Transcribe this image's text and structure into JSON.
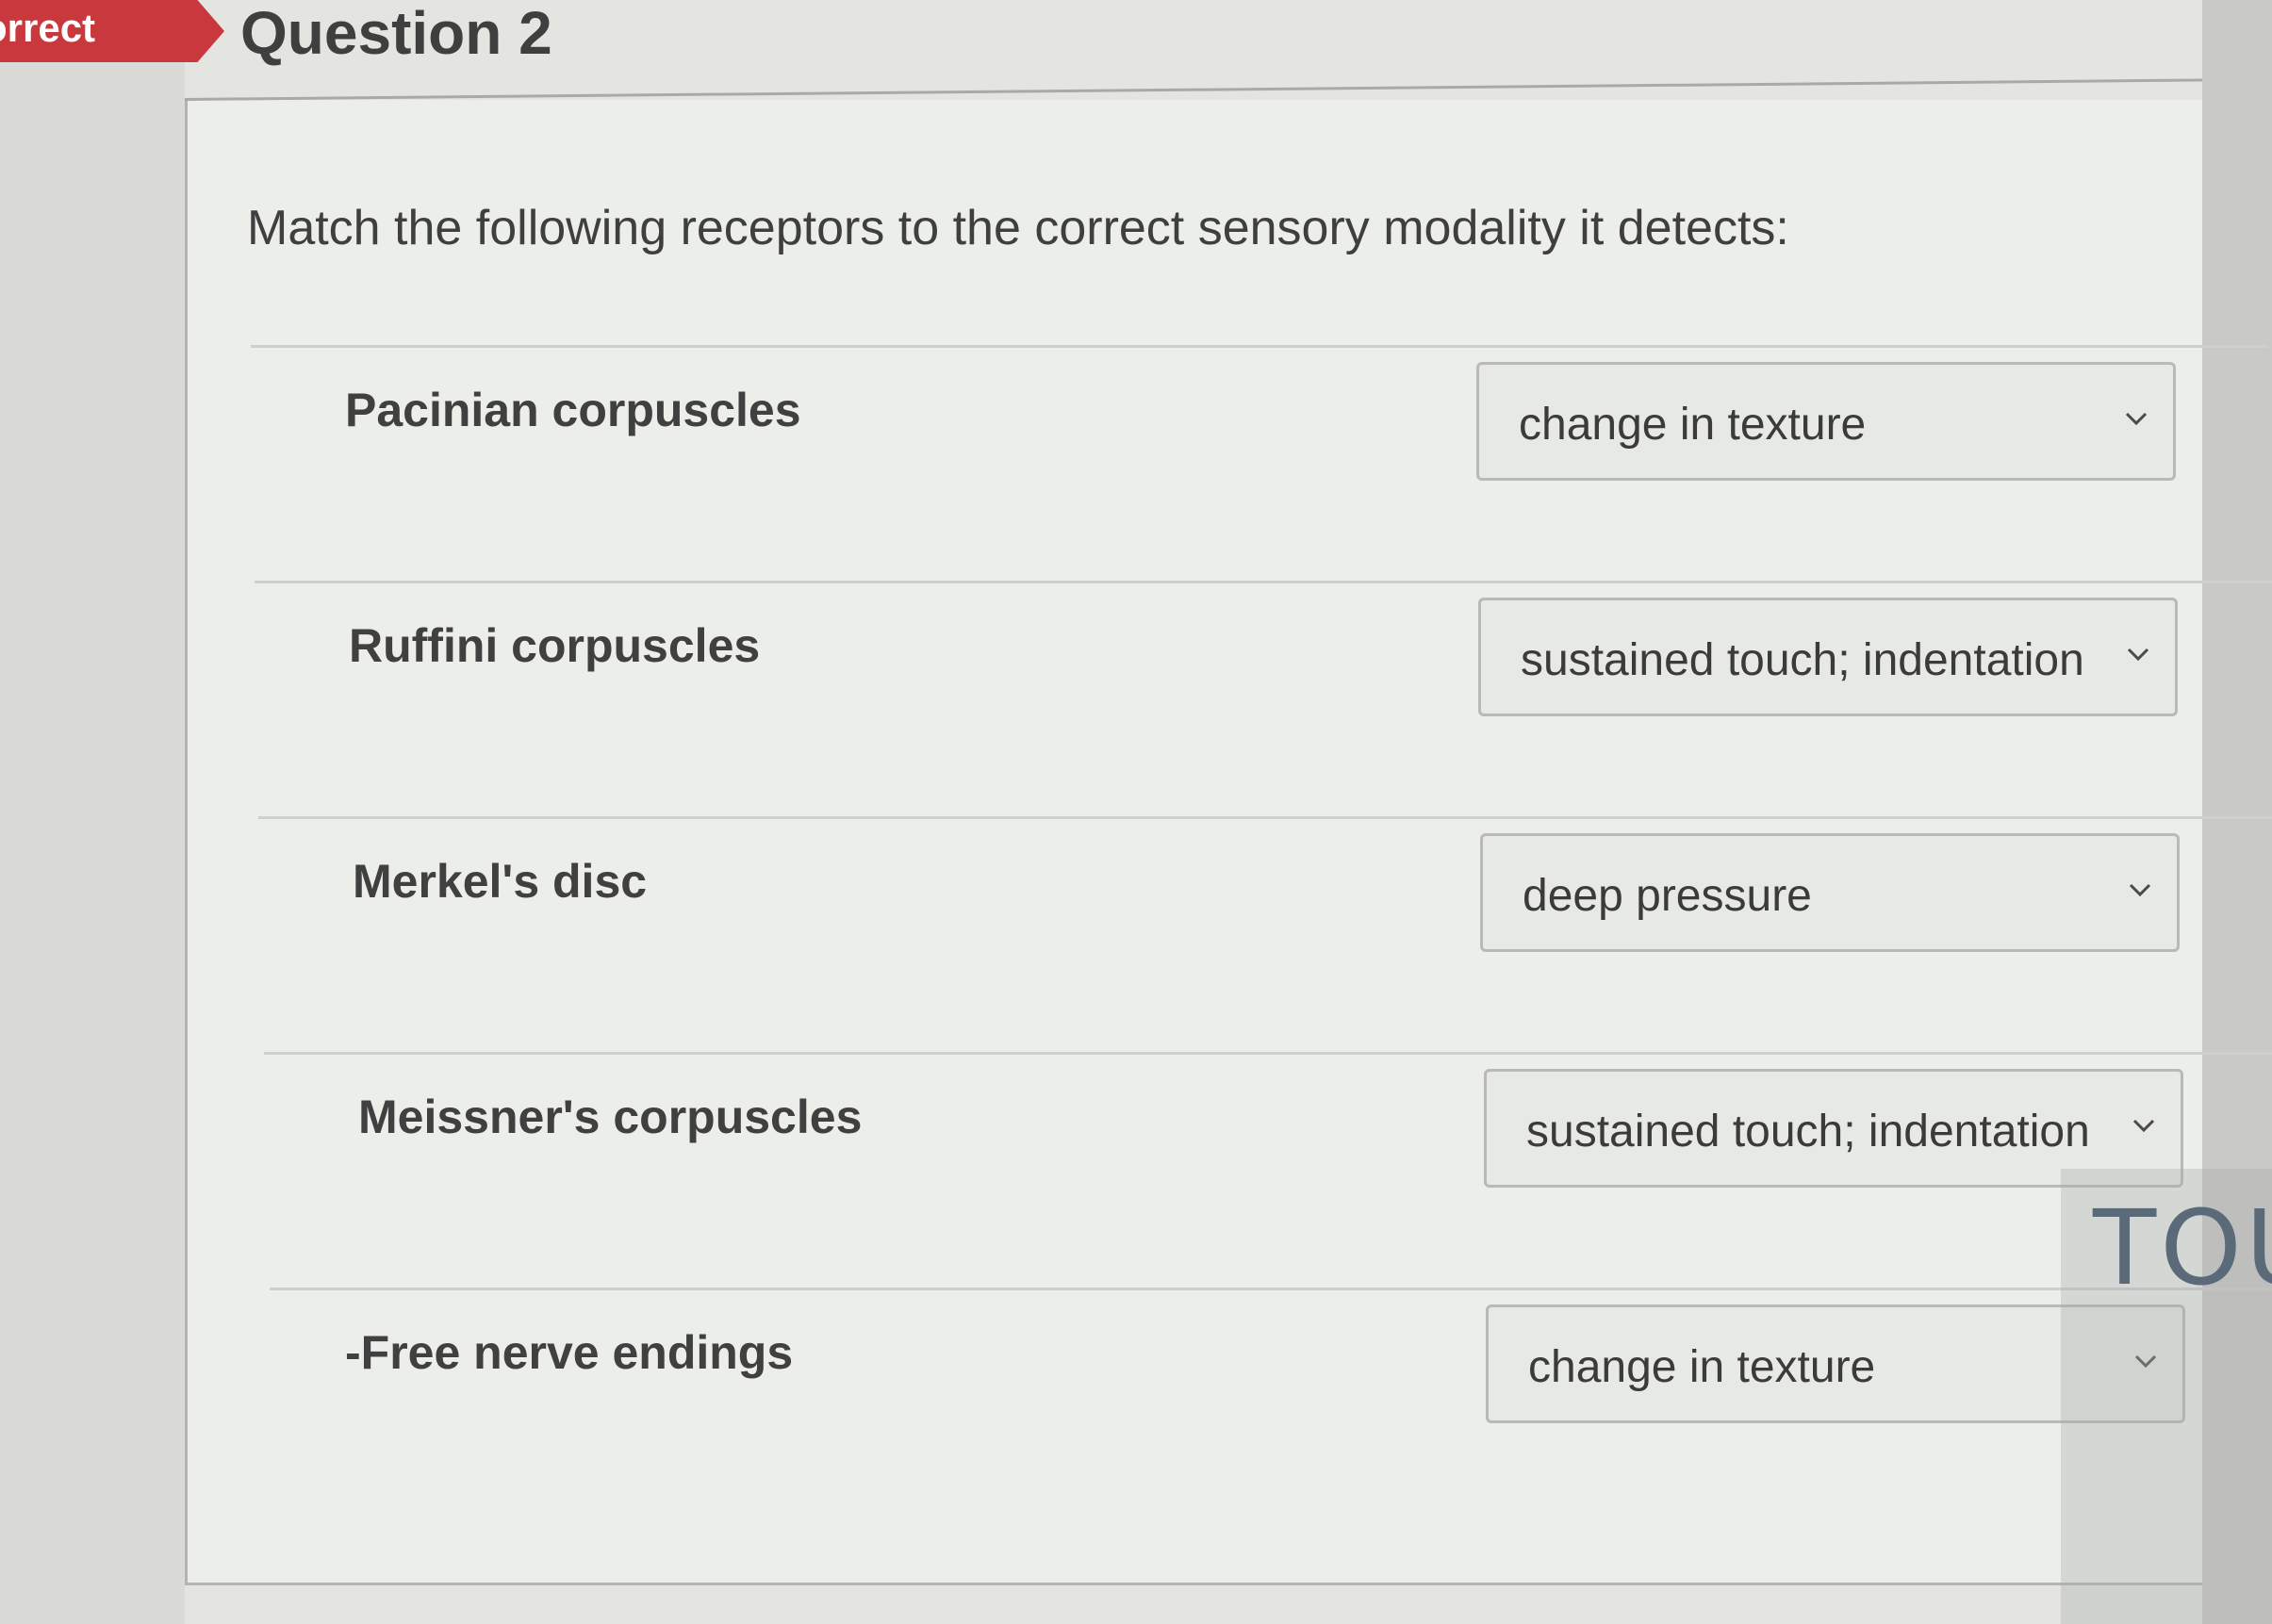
{
  "status": {
    "label": "orrect"
  },
  "question": {
    "title": "Question 2",
    "prompt": "Match the following receptors to the correct sensory modality it detects:"
  },
  "matches": [
    {
      "receptor": "Pacinian corpuscles",
      "selected": "change in texture"
    },
    {
      "receptor": "Ruffini corpuscles",
      "selected": "sustained touch; indentation"
    },
    {
      "receptor": "Merkel's disc",
      "selected": "deep pressure"
    },
    {
      "receptor": "Meissner's corpuscles",
      "selected": "sustained touch; indentation"
    },
    {
      "receptor": "-Free nerve endings",
      "selected": "change in texture"
    }
  ],
  "handwritten_note": "TOU",
  "icons": {
    "dropdown": "chevron-down-icon"
  },
  "colors": {
    "status_flag": "#c8383c",
    "card_background": "#eceeea",
    "select_background": "#e7e9e5"
  }
}
